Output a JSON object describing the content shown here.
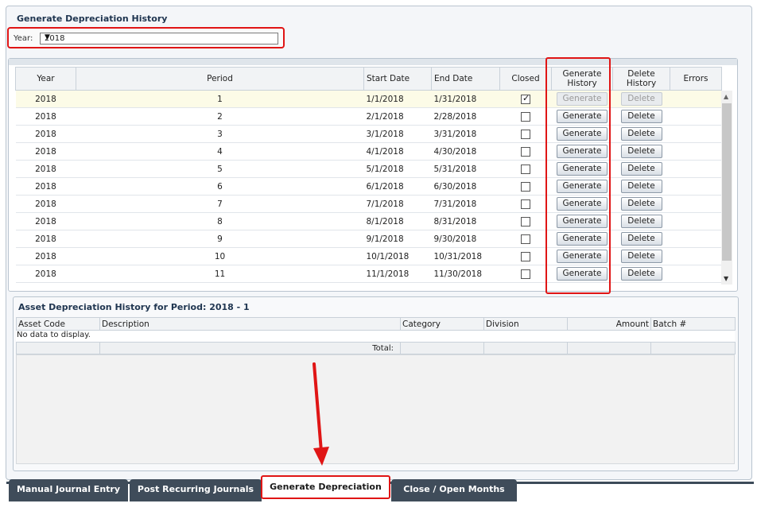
{
  "panel": {
    "title": "Generate Depreciation History"
  },
  "year": {
    "label": "Year:",
    "value": "2018"
  },
  "grid": {
    "columns": [
      "Year",
      "Period",
      "Start Date",
      "End Date",
      "Closed",
      "Generate History",
      "Delete History",
      "Errors"
    ],
    "rows": [
      {
        "year": "2018",
        "period": "1",
        "start": "1/1/2018",
        "end": "1/31/2018",
        "closed": true,
        "generate": "Generate",
        "delete": "Delete"
      },
      {
        "year": "2018",
        "period": "2",
        "start": "2/1/2018",
        "end": "2/28/2018",
        "closed": false,
        "generate": "Generate",
        "delete": "Delete"
      },
      {
        "year": "2018",
        "period": "3",
        "start": "3/1/2018",
        "end": "3/31/2018",
        "closed": false,
        "generate": "Generate",
        "delete": "Delete"
      },
      {
        "year": "2018",
        "period": "4",
        "start": "4/1/2018",
        "end": "4/30/2018",
        "closed": false,
        "generate": "Generate",
        "delete": "Delete"
      },
      {
        "year": "2018",
        "period": "5",
        "start": "5/1/2018",
        "end": "5/31/2018",
        "closed": false,
        "generate": "Generate",
        "delete": "Delete"
      },
      {
        "year": "2018",
        "period": "6",
        "start": "6/1/2018",
        "end": "6/30/2018",
        "closed": false,
        "generate": "Generate",
        "delete": "Delete"
      },
      {
        "year": "2018",
        "period": "7",
        "start": "7/1/2018",
        "end": "7/31/2018",
        "closed": false,
        "generate": "Generate",
        "delete": "Delete"
      },
      {
        "year": "2018",
        "period": "8",
        "start": "8/1/2018",
        "end": "8/31/2018",
        "closed": false,
        "generate": "Generate",
        "delete": "Delete"
      },
      {
        "year": "2018",
        "period": "9",
        "start": "9/1/2018",
        "end": "9/30/2018",
        "closed": false,
        "generate": "Generate",
        "delete": "Delete"
      },
      {
        "year": "2018",
        "period": "10",
        "start": "10/1/2018",
        "end": "10/31/2018",
        "closed": false,
        "generate": "Generate",
        "delete": "Delete"
      },
      {
        "year": "2018",
        "period": "11",
        "start": "11/1/2018",
        "end": "11/30/2018",
        "closed": false,
        "generate": "Generate",
        "delete": "Delete"
      }
    ]
  },
  "asset": {
    "title": "Asset Depreciation History for Period: 2018 - 1",
    "columns": [
      "Asset Code",
      "Description",
      "Category",
      "Division",
      "Amount",
      "Batch #"
    ],
    "no_data": "No data to display.",
    "total_label": "Total:"
  },
  "tabs": [
    "Manual Journal Entry",
    "Post Recurring Journals",
    "Generate Depreciation",
    "Close / Open Months"
  ],
  "active_tab": "Generate Depreciation",
  "colors": {
    "highlight": "#e01515",
    "tab_dark": "#3f4c5a",
    "title": "#1f3550"
  }
}
